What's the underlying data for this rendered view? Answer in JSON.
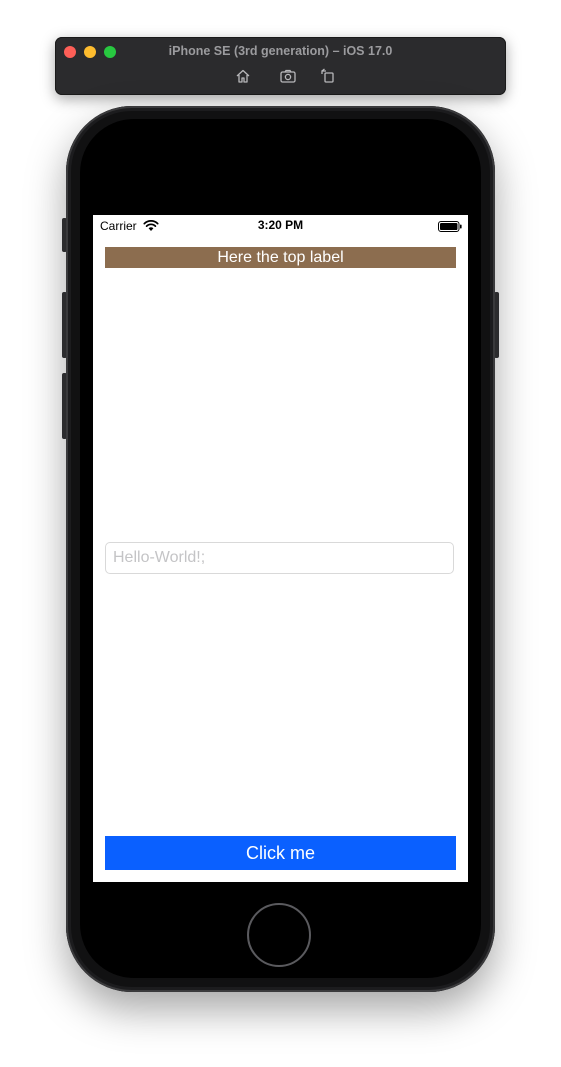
{
  "simulator": {
    "title": "iPhone SE (3rd generation) – iOS 17.0",
    "tools": [
      "home-icon",
      "screenshot-icon",
      "rotate-icon"
    ]
  },
  "status_bar": {
    "carrier": "Carrier",
    "time": "3:20 PM"
  },
  "app": {
    "top_label": "Here the top label",
    "text_field_placeholder": "Hello-World!;",
    "text_field_value": "",
    "button_label": "Click me"
  },
  "colors": {
    "top_label_bg": "#8c6d4f",
    "button_bg": "#0a60ff"
  }
}
